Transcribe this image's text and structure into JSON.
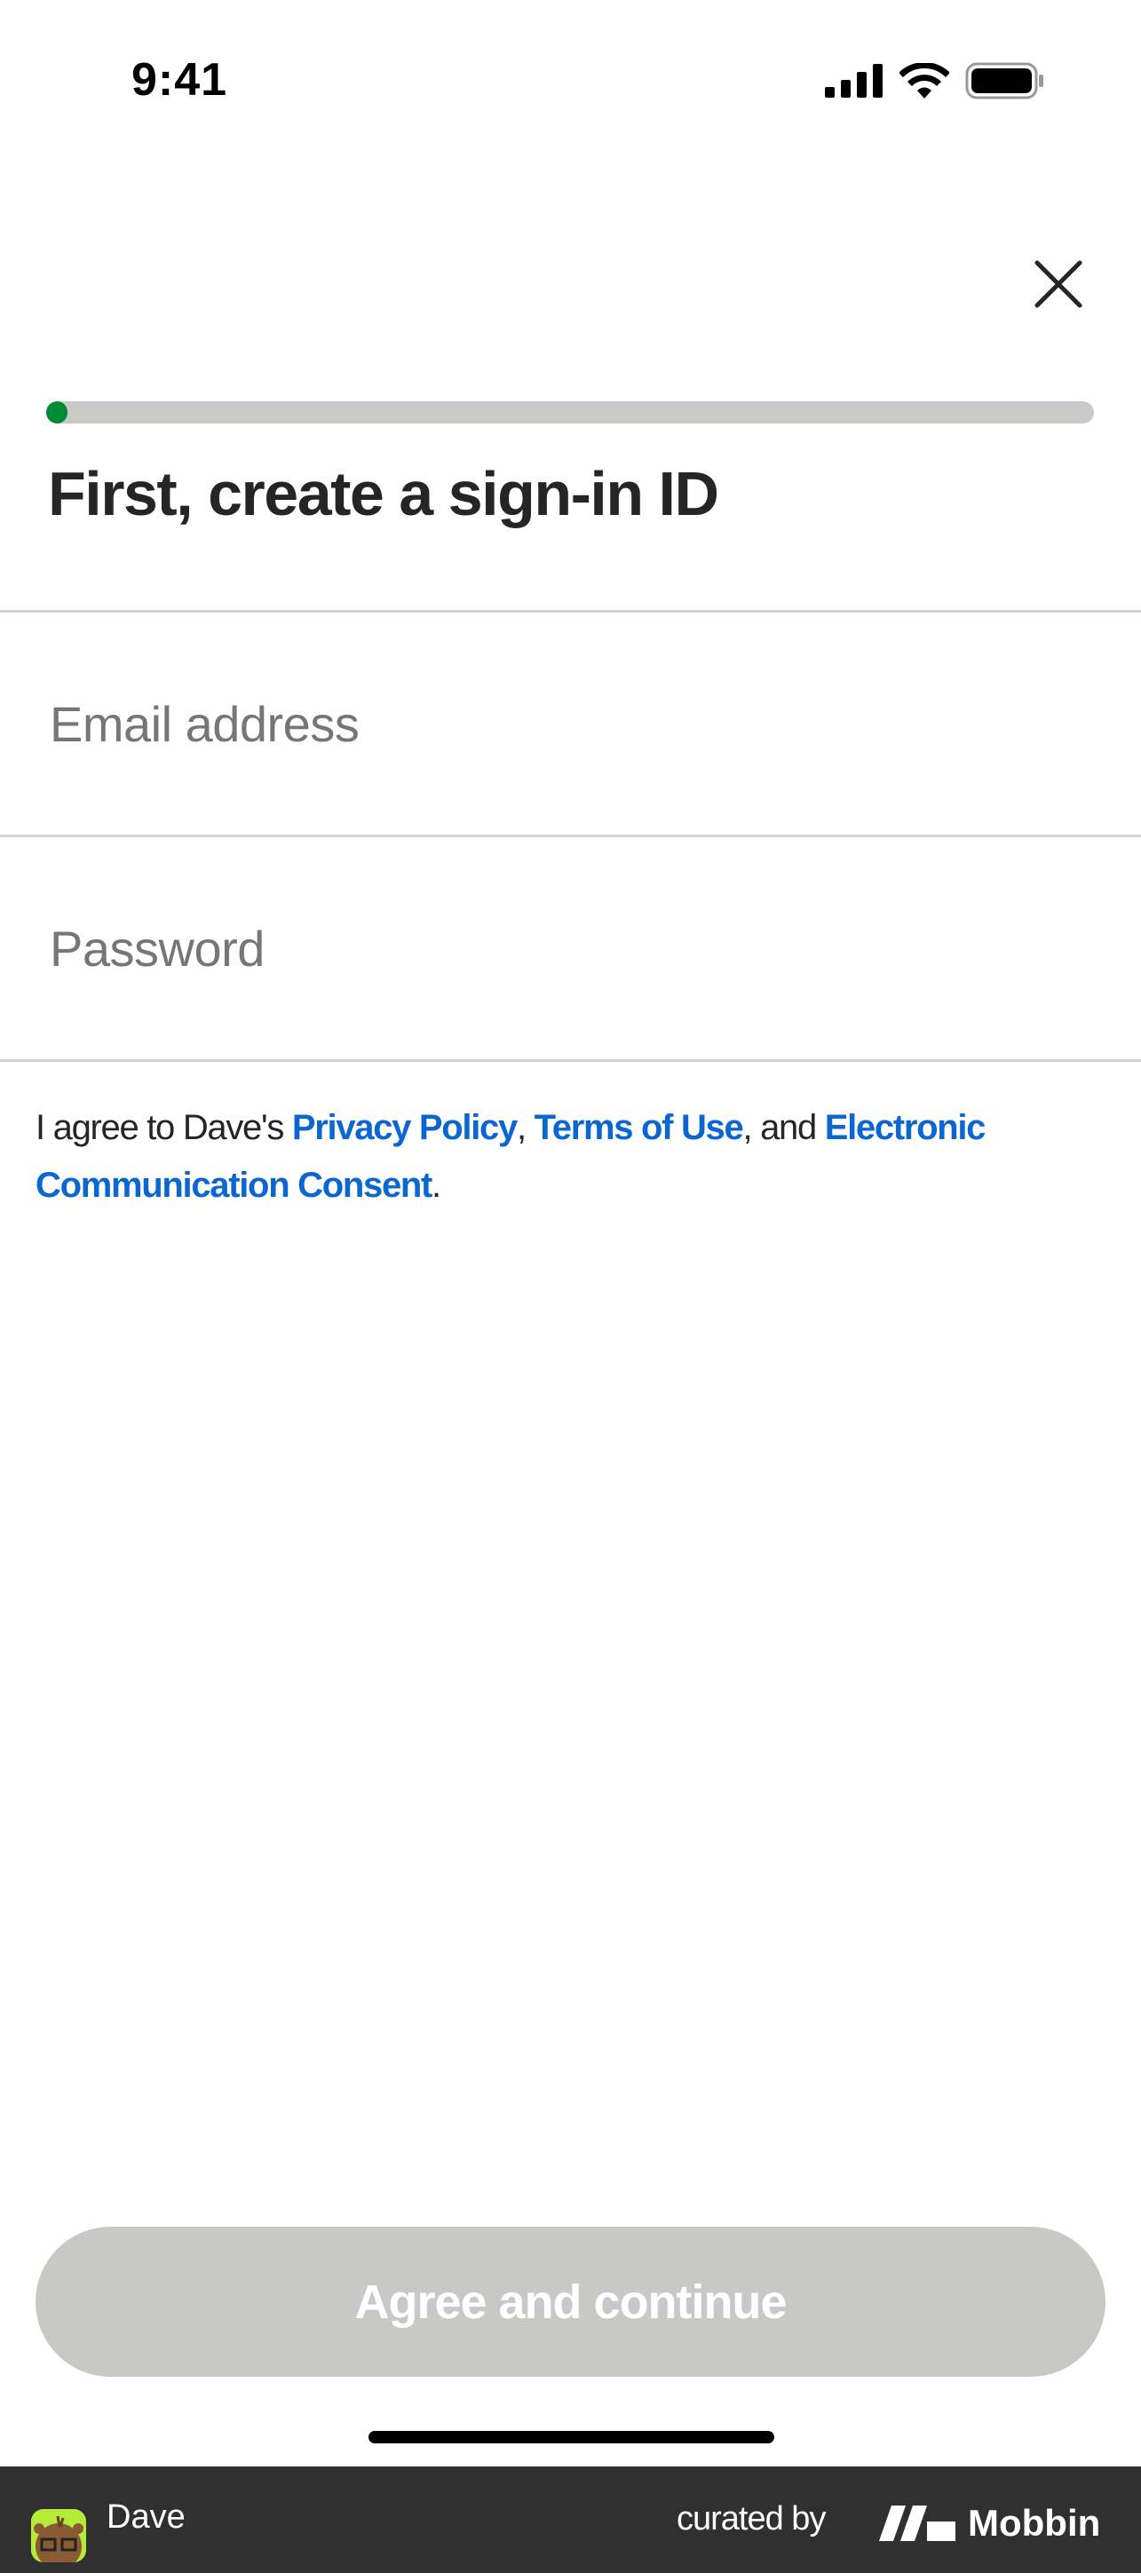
{
  "status_bar": {
    "time": "9:41",
    "icons": [
      "cellular-signal-icon",
      "wifi-icon",
      "battery-icon"
    ]
  },
  "header": {
    "close_icon": "close-icon"
  },
  "progress": {
    "percent": 2,
    "color": "#008a34",
    "track_color": "#c9c9c7"
  },
  "title": "First, create a sign-in ID",
  "form": {
    "email": {
      "value": "",
      "placeholder": "Email address"
    },
    "password": {
      "value": "",
      "placeholder": "Password"
    }
  },
  "agreement": {
    "prefix": "I agree to Dave's ",
    "privacy_policy": "Privacy Policy",
    "sep1": ", ",
    "terms": "Terms of Use",
    "sep2": ", and ",
    "consent": "Electronic Communication Consent",
    "suffix": ".",
    "link_color": "#0a66d1"
  },
  "primary_button": {
    "label": "Agree and continue",
    "disabled": true
  },
  "footer": {
    "app_name": "Dave",
    "curated_by": "curated by",
    "brand": "Mobbin"
  }
}
